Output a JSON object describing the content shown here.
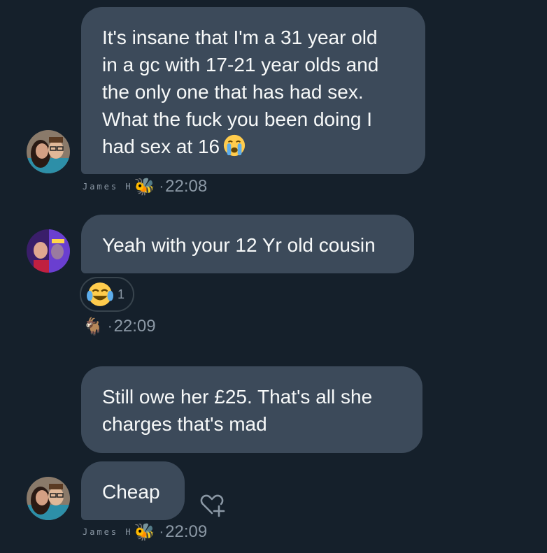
{
  "colors": {
    "background": "#15202b",
    "bubble": "#3c4a5a",
    "text": "#f7f9f9",
    "meta": "#8b98a5"
  },
  "messages": [
    {
      "text": "It's insane that I'm a 31 year old\nin a gc with 17-21 year olds and\nthe only one that has had sex.\nWhat the fuck you been doing I\nhad sex at 16",
      "trailing_emoji": "loudly-crying-face",
      "sender": "James H",
      "sender_emoji": "🐝",
      "time": "22:08"
    },
    {
      "text": "Yeah with your 12 Yr old cousin",
      "reaction": {
        "emoji": "face-with-tears-of-joy",
        "count": "1"
      },
      "sender": "",
      "sender_emoji": "🐐",
      "time": "22:09"
    },
    {
      "text": "Still owe her £25. That's all she\ncharges that's mad",
      "sender": "",
      "time": ""
    },
    {
      "text": "Cheap",
      "sender": "James H",
      "sender_emoji": "🐝",
      "time": "22:09",
      "action_icon": "heart-plus-icon"
    }
  ],
  "meta_separator": "·"
}
